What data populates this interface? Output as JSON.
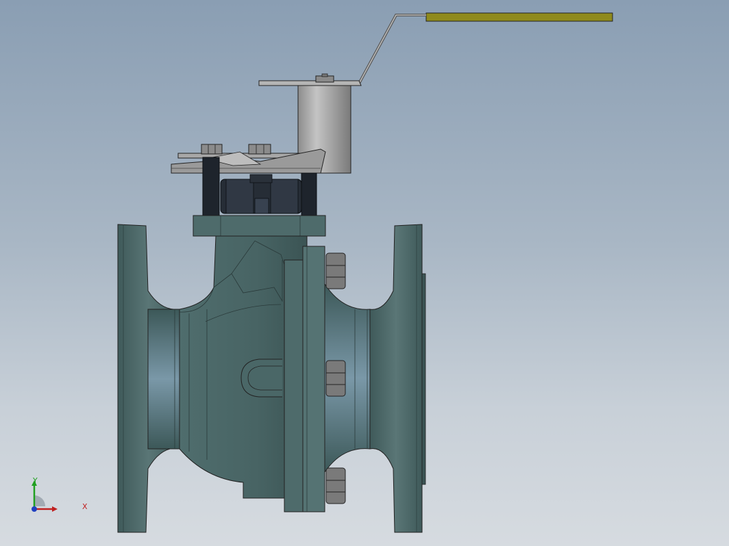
{
  "viewport": {
    "background_top": "#8a9eb3",
    "background_bottom": "#d6dbe0"
  },
  "model": {
    "body_color": "#4b6666",
    "body_shade": "#3e5858",
    "stem_housing_color": "#9a9a9a",
    "handle_grip_color": "#8f8a1c",
    "fastener_color": "#1e242c"
  },
  "triad": {
    "x_label": "X",
    "y_label": "Y",
    "x_color": "#c02020",
    "y_color": "#20a020",
    "z_color": "#2040c0"
  }
}
